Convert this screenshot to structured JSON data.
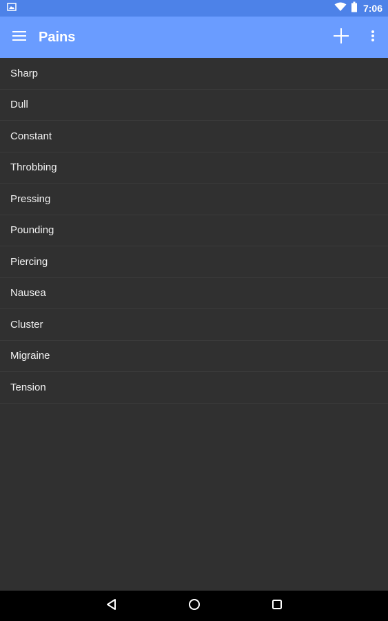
{
  "status_bar": {
    "time": "7:06",
    "icons": [
      "image-notification-icon",
      "wifi-icon",
      "battery-icon"
    ],
    "color": "#4d82e8"
  },
  "app_bar": {
    "title": "Pains",
    "color": "#6a9cff",
    "icons": [
      "hamburger-menu-icon",
      "add-icon",
      "overflow-menu-icon"
    ]
  },
  "pains": {
    "items": [
      {
        "label": "Sharp"
      },
      {
        "label": "Dull"
      },
      {
        "label": "Constant"
      },
      {
        "label": "Throbbing"
      },
      {
        "label": "Pressing"
      },
      {
        "label": "Pounding"
      },
      {
        "label": "Piercing"
      },
      {
        "label": "Nausea"
      },
      {
        "label": "Cluster"
      },
      {
        "label": "Migraine"
      },
      {
        "label": "Tension"
      }
    ]
  },
  "nav_bar": {
    "icons": [
      "back-icon",
      "home-icon",
      "recents-icon"
    ]
  }
}
